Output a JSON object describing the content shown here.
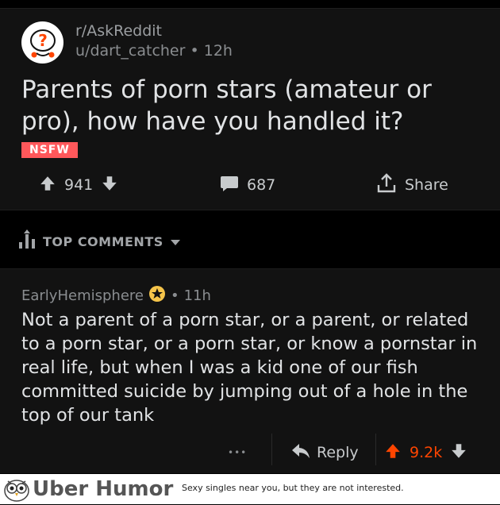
{
  "post": {
    "subreddit": "r/AskReddit",
    "user": "u/dart_catcher",
    "age": "12h",
    "meta_sep": "•",
    "title": "Parents of porn stars (amateur or pro), how have you handled it?",
    "nsfw_tag": "NSFW",
    "score": "941",
    "comments": "687",
    "share_label": "Share"
  },
  "sort": {
    "label": "TOP COMMENTS"
  },
  "comment": {
    "author": "EarlyHemisphere",
    "age": "11h",
    "meta_sep": "•",
    "body": "Not a parent of a porn star, or a parent, or related to a porn star, or a porn star, or know a pornstar in real life, but when I was a kid one of our fish committed suicide by jumping out of a hole in the top of our tank",
    "more_label": "•••",
    "reply_label": "Reply",
    "score": "9.2k"
  },
  "footer": {
    "brand": "Uber Humor",
    "tagline": "Sexy singles near you, but they are not interested."
  },
  "colors": {
    "upvote": "#ff4500",
    "nsfw": "#ff585b",
    "card_bg": "#121212"
  },
  "icons": [
    "snoo-question-icon",
    "upvote-icon",
    "downvote-icon",
    "comment-icon",
    "share-icon",
    "sort-bars-icon",
    "caret-down-icon",
    "award-star-icon",
    "more-dots-icon",
    "reply-icon",
    "owl-logo-icon"
  ]
}
